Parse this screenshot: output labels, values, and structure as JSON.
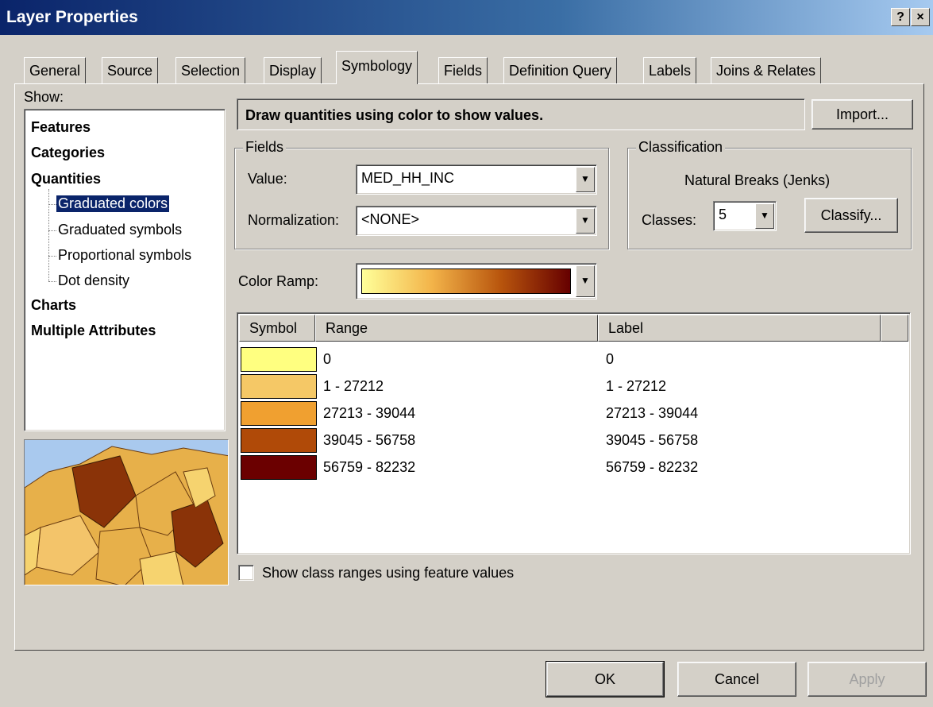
{
  "window": {
    "title": "Layer Properties",
    "help_button": "?",
    "close_button": "×"
  },
  "tabs": [
    "General",
    "Source",
    "Selection",
    "Display",
    "Symbology",
    "Fields",
    "Definition Query",
    "Labels",
    "Joins & Relates"
  ],
  "active_tab": "Symbology",
  "show": {
    "label": "Show:",
    "tree": {
      "features": "Features",
      "categories": "Categories",
      "quantities": "Quantities",
      "graduated_colors": "Graduated colors",
      "graduated_symbols": "Graduated symbols",
      "proportional_symbols": "Proportional symbols",
      "dot_density": "Dot density",
      "charts": "Charts",
      "multiple_attributes": "Multiple Attributes"
    }
  },
  "description": "Draw quantities using color to show values.",
  "import_button": "Import...",
  "fields": {
    "legend": "Fields",
    "value_label": "Value:",
    "value": "MED_HH_INC",
    "normalization_label": "Normalization:",
    "normalization": "<NONE>"
  },
  "classification": {
    "legend": "Classification",
    "method": "Natural Breaks (Jenks)",
    "classes_label": "Classes:",
    "classes": "5",
    "classify_button": "Classify..."
  },
  "color_ramp": {
    "label": "Color Ramp:",
    "colors": [
      "#ffff99",
      "#f3b44a",
      "#b8550d",
      "#660000"
    ]
  },
  "table": {
    "headers": {
      "symbol": "Symbol",
      "range": "Range",
      "label": "Label"
    },
    "rows": [
      {
        "color": "#ffff80",
        "range": "0",
        "label": "0"
      },
      {
        "color": "#f5c866",
        "range": "1 - 27212",
        "label": "1 - 27212"
      },
      {
        "color": "#f0a030",
        "range": "27213 - 39044",
        "label": "27213 - 39044"
      },
      {
        "color": "#b04a08",
        "range": "39045 - 56758",
        "label": "39045 - 56758"
      },
      {
        "color": "#6b0000",
        "range": "56759 - 82232",
        "label": "56759 - 82232"
      }
    ]
  },
  "show_class_ranges": {
    "label": "Show class ranges using feature values",
    "checked": false
  },
  "buttons": {
    "ok": "OK",
    "cancel": "Cancel",
    "apply": "Apply"
  }
}
